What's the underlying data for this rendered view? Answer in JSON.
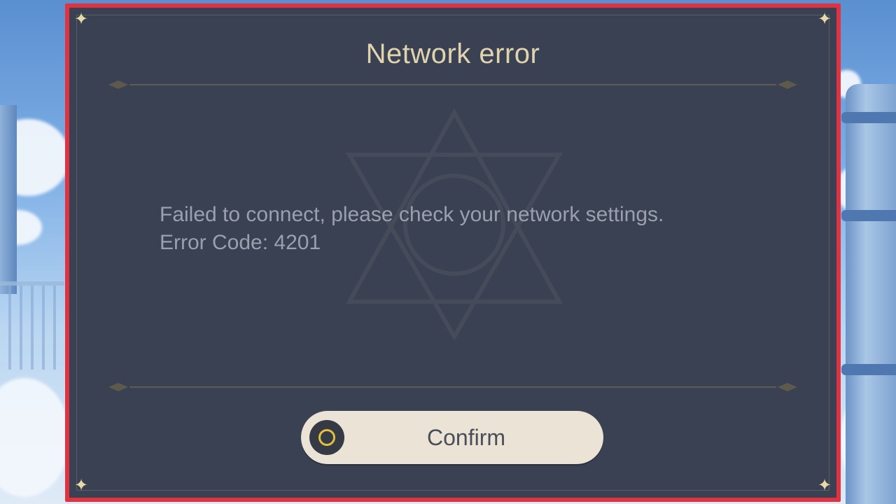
{
  "dialog": {
    "title": "Network error",
    "message_line1": "Failed to connect, please check your network settings.",
    "message_line2": "Error Code: 4201",
    "confirm_label": "Confirm",
    "confirm_icon": "circle-button-icon"
  },
  "colors": {
    "highlight_frame": "#e2313f",
    "dialog_bg": "#3a4152",
    "title": "#e0d3ad",
    "message": "#9aa0ad",
    "button_bg": "#ebe4d6",
    "button_icon_ring": "#e2c13a"
  }
}
